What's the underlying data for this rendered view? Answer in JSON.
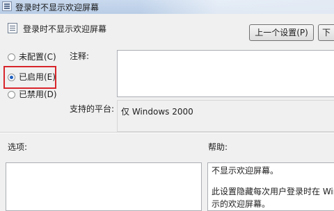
{
  "window": {
    "title": "登录时不显示欢迎屏幕",
    "title_icon": "policy-window-icon"
  },
  "policy": {
    "name": "登录时不显示欢迎屏幕",
    "icon": "policy-setting-icon"
  },
  "nav": {
    "prev_label": "上一个设置(P)",
    "next_label": "下"
  },
  "state": {
    "options": [
      {
        "label": "未配置(C)",
        "checked": false
      },
      {
        "label": "已启用(E)",
        "checked": true
      },
      {
        "label": "已禁用(D)",
        "checked": false
      }
    ],
    "highlight_color": "#d8252b"
  },
  "comment": {
    "label": "注释:",
    "value": ""
  },
  "platform": {
    "label": "支持的平台:",
    "value": "仅 Windows 2000"
  },
  "options_section": {
    "label": "选项:"
  },
  "help_section": {
    "label": "帮助:",
    "lines": [
      "不显示欢迎屏幕。",
      "此设置隐藏每次用户登录时在 Wind",
      "示的欢迎屏幕。"
    ]
  },
  "colors": {
    "accent": "#1f5fbf",
    "titlebar": "#c9d9ee"
  }
}
